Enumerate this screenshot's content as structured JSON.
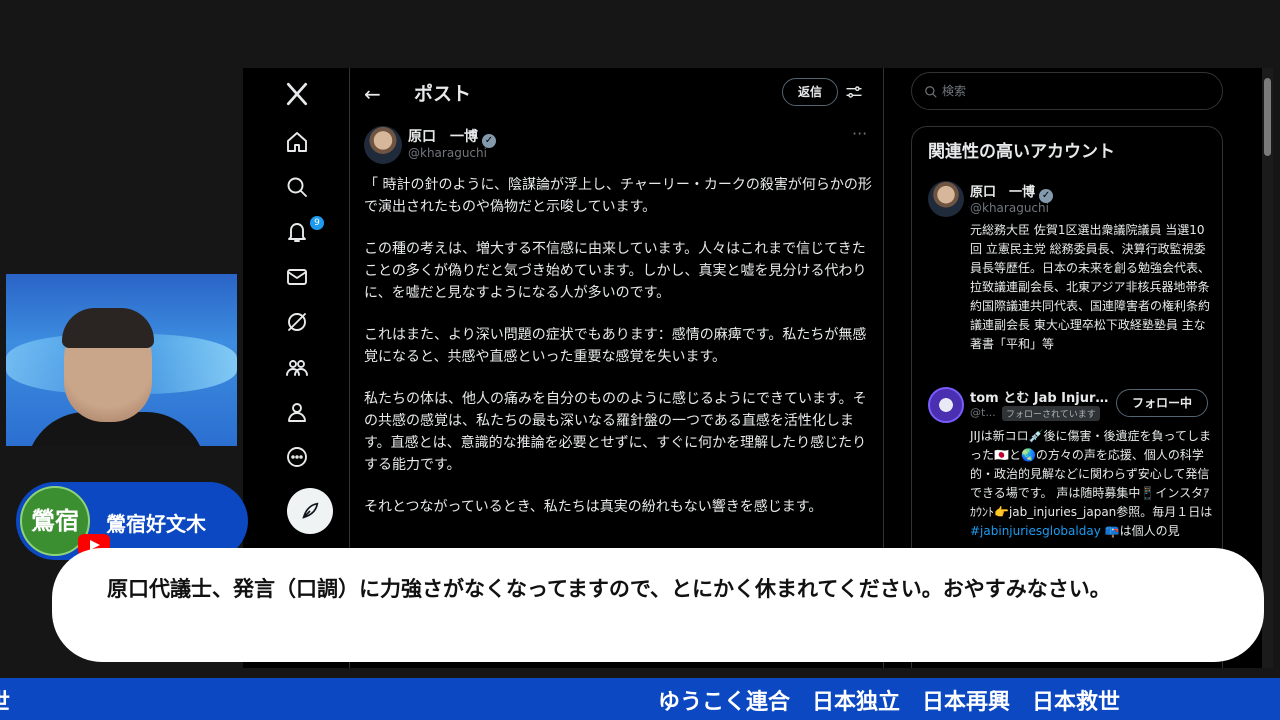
{
  "nav": {
    "badge_count": "9"
  },
  "header": {
    "title": "ポスト",
    "back_icon": "←",
    "reply_label": "返信"
  },
  "post": {
    "author_name": "原口　一博",
    "author_handle": "@kharaguchi",
    "more_icon": "···",
    "paragraphs": [
      "「 時計の針のように、陰謀論が浮上し、チャーリー・カークの殺害が何らかの形で演出されたものや偽物だと示唆しています。",
      "この種の考えは、増大する不信感に由来しています。人々はこれまで信じてきたことの多くが偽りだと気づき始めています。しかし、真実と嘘を見分ける代わりに、を嘘だと見なすようになる人が多いのです。",
      "これはまた、より深い問題の症状でもあります：感情の麻痺です。私たちが無感覚になると、共感や直感といった重要な感覚を失います。",
      "私たちの体は、他人の痛みを自分のもののように感じるようにできています。その共感の感覚は、私たちの最も深いなる羅針盤の一つである直感を活性化します。直感とは、意識的な推論を必要とせずに、すぐに何かを理解したり感じたりする能力です。",
      "それとつながっているとき、私たちは真実の紛れもない響きを感じます。"
    ]
  },
  "search": {
    "placeholder": "検索"
  },
  "related": {
    "title": "関連性の高いアカウント",
    "accounts": [
      {
        "name": "原口　一博",
        "handle": "@kharaguchi",
        "bio": "元総務大臣 佐賀1区選出衆議院議員 当選10回 立憲民主党 総務委員長、決算行政監視委員長等歴任。日本の未来を創る勉強会代表、拉致議連副会長、北東アジア非核兵器地帯条約国際議連共同代表、国連障害者の権利条約議連副会長 東大心理卒松下政経塾塾員 主な著書「平和」等"
      },
      {
        "name": "tom とむ Jab Injuri...",
        "handle": "@t...",
        "follows_you": "フォローされています",
        "follow_label": "フォロー中",
        "bio_main": "JIJは新コロ💉後に傷害・後遺症を負ってしまった🇯🇵と🌏の方々の声を応援、個人の科学的・政治的見解などに関わらず安心して発信できる場です。 声は随時募集中📱インスタｱｶｳﾝﾄ👉jab_injuries_japan参照。毎月１日は",
        "bio_hashtag": "#jabinjuriesglobalday",
        "bio_tail": " 📪は個人の見"
      }
    ]
  },
  "channel": {
    "logo_text": "鶯宿",
    "name": "鶯宿好文木"
  },
  "comment": {
    "text": "原口代議士、発言（口調）に力強さがなくなってますので、とにかく休まれてください。おやすみなさい。"
  },
  "ticker": {
    "left_fragment": "世",
    "right_text": "ゆうこく連合　日本独立　日本再興　日本救世"
  },
  "colors": {
    "x_background": "#000000",
    "accent_blue": "#1d9bf0",
    "ticker_blue": "#0b48c2",
    "bubble": "#ffffff"
  },
  "icons": {
    "nav": [
      "x-logo-icon",
      "home-icon",
      "search-icon",
      "bell-icon",
      "mail-icon",
      "grok-icon",
      "communities-icon",
      "profile-icon",
      "more-circle-icon",
      "compose-icon"
    ]
  }
}
